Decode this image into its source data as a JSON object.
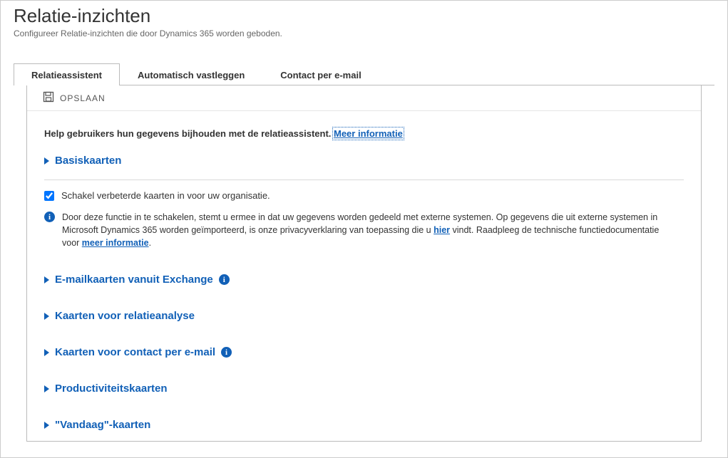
{
  "header": {
    "title": "Relatie-inzichten",
    "subtitle": "Configureer Relatie-inzichten die door Dynamics 365 worden geboden."
  },
  "tabs": [
    {
      "label": "Relatieassistent",
      "active": true
    },
    {
      "label": "Automatisch vastleggen",
      "active": false
    },
    {
      "label": "Contact per e-mail",
      "active": false
    }
  ],
  "toolbar": {
    "save_label": "OPSLAAN"
  },
  "content": {
    "help_prefix": "Help gebruikers hun gegevens bijhouden met de relatieassistent. ",
    "help_link": "Meer informatie",
    "sections": {
      "basiskaarten": "Basiskaarten",
      "email_exchange": "E-mailkaarten vanuit Exchange",
      "relatieanalyse": "Kaarten voor relatieanalyse",
      "contact_email": "Kaarten voor contact per e-mail",
      "productiviteit": "Productiviteitskaarten",
      "vandaag": "\"Vandaag\"-kaarten"
    },
    "enable_checkbox": {
      "checked": true,
      "label": "Schakel verbeterde kaarten in voor uw organisatie."
    },
    "info_notice": {
      "part1": "Door deze functie in te schakelen, stemt u ermee in dat uw gegevens worden gedeeld met externe systemen. Op gegevens die uit externe systemen in Microsoft Dynamics 365 worden geïmporteerd, is onze privacyverklaring van toepassing die u ",
      "link_here": "hier",
      "part2": " vindt. Raadpleeg de technische functiedocumentatie voor ",
      "link_more": "meer informatie",
      "part3": "."
    }
  }
}
